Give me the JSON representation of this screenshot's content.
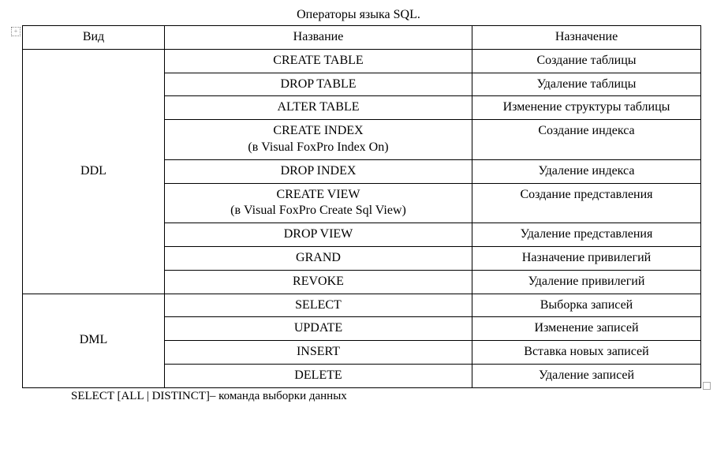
{
  "title": "Операторы языка SQL.",
  "headers": {
    "kind": "Вид",
    "name": "Название",
    "purpose": "Назначение"
  },
  "groups": [
    {
      "kind": "DDL",
      "rows": [
        {
          "name_lines": [
            "CREATE TABLE"
          ],
          "purpose": "Создание таблицы"
        },
        {
          "name_lines": [
            "DROP TABLE"
          ],
          "purpose": "Удаление таблицы"
        },
        {
          "name_lines": [
            "ALTER TABLE"
          ],
          "purpose": "Изменение структуры таблицы"
        },
        {
          "name_lines": [
            "CREATE INDEX",
            "(в Visual FoxPro Index On)"
          ],
          "purpose": "Создание индекса"
        },
        {
          "name_lines": [
            "DROP INDEX"
          ],
          "purpose": "Удаление индекса"
        },
        {
          "name_lines": [
            "CREATE VIEW",
            "(в Visual FoxPro Create Sql View)"
          ],
          "purpose": "Создание представления"
        },
        {
          "name_lines": [
            "DROP VIEW"
          ],
          "purpose": "Удаление представления"
        },
        {
          "name_lines": [
            "GRAND"
          ],
          "purpose": "Назначение привилегий"
        },
        {
          "name_lines": [
            "REVOKE"
          ],
          "purpose": "Удаление привилегий"
        }
      ]
    },
    {
      "kind": "DML",
      "rows": [
        {
          "name_lines": [
            "SELECT"
          ],
          "purpose": "Выборка записей"
        },
        {
          "name_lines": [
            "UPDATE"
          ],
          "purpose": "Изменение записей"
        },
        {
          "name_lines": [
            "INSERT"
          ],
          "purpose": "Вставка новых записей"
        },
        {
          "name_lines": [
            "DELETE"
          ],
          "purpose": "Удаление записей"
        }
      ]
    }
  ],
  "footer_fragment": "SELECT [ALL | DISTINCT]– команда выборки данных",
  "chart_data": {
    "type": "table",
    "title": "Операторы языка SQL.",
    "columns": [
      "Вид",
      "Название",
      "Назначение"
    ],
    "rows": [
      [
        "DDL",
        "CREATE TABLE",
        "Создание таблицы"
      ],
      [
        "DDL",
        "DROP TABLE",
        "Удаление таблицы"
      ],
      [
        "DDL",
        "ALTER TABLE",
        "Изменение структуры таблицы"
      ],
      [
        "DDL",
        "CREATE INDEX (в Visual FoxPro Index On)",
        "Создание индекса"
      ],
      [
        "DDL",
        "DROP INDEX",
        "Удаление индекса"
      ],
      [
        "DDL",
        "CREATE VIEW (в Visual FoxPro Create Sql View)",
        "Создание представления"
      ],
      [
        "DDL",
        "DROP VIEW",
        "Удаление представления"
      ],
      [
        "DDL",
        "GRAND",
        "Назначение привилегий"
      ],
      [
        "DDL",
        "REVOKE",
        "Удаление привилегий"
      ],
      [
        "DML",
        "SELECT",
        "Выборка записей"
      ],
      [
        "DML",
        "UPDATE",
        "Изменение записей"
      ],
      [
        "DML",
        "INSERT",
        "Вставка новых записей"
      ],
      [
        "DML",
        "DELETE",
        "Удаление записей"
      ]
    ]
  }
}
